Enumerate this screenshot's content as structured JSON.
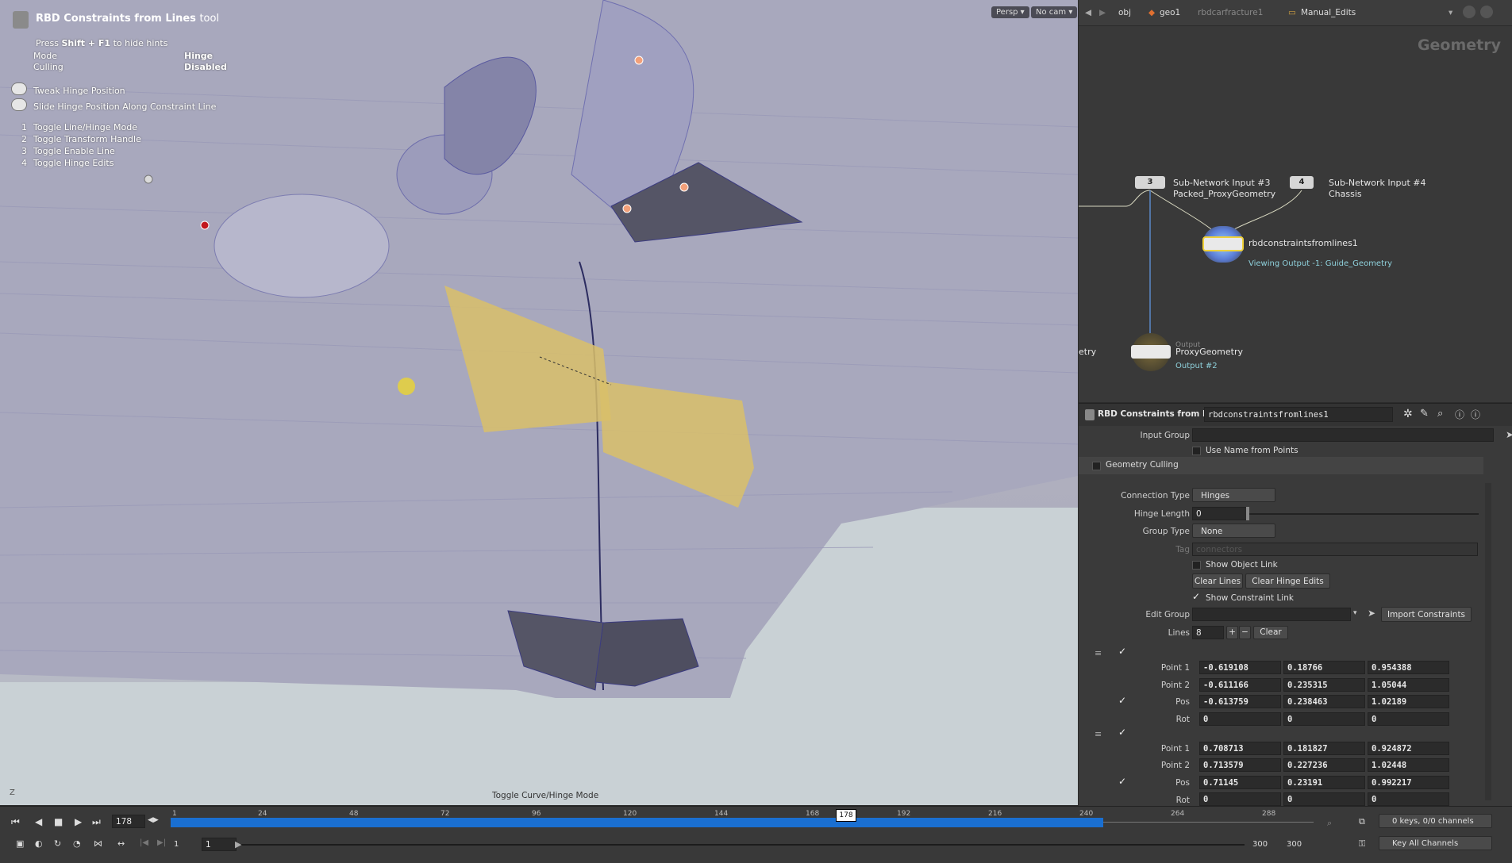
{
  "viewport": {
    "tool_title": "RBD Constraints from Lines",
    "tool_suffix": "tool",
    "hint_press": "Press",
    "hint_keys": "Shift + F1",
    "hint_rest": "to hide hints",
    "mode_label": "Mode",
    "mode_value": "Hinge",
    "culling_label": "Culling",
    "culling_value": "Disabled",
    "mouse_hints": [
      "Tweak Hinge Position",
      "Slide Hinge Position Along Constraint Line"
    ],
    "key_hints": [
      {
        "key": "1",
        "label": "Toggle Line/Hinge Mode"
      },
      {
        "key": "2",
        "label": "Toggle Transform Handle"
      },
      {
        "key": "3",
        "label": "Toggle Enable Line"
      },
      {
        "key": "4",
        "label": "Toggle Hinge Edits"
      }
    ],
    "camera_menu": "Persp",
    "cam_menu": "No cam",
    "status_text": "Toggle Curve/Hinge Mode",
    "axis_label": "Z"
  },
  "network": {
    "breadcrumbs": [
      "obj",
      "geo1",
      "rbdcarfracture1",
      "Manual_Edits"
    ],
    "context_label": "Geometry",
    "nodes": {
      "input3_num": "3",
      "input3_title": "Sub-Network Input #3",
      "input3_sub": "Packed_ProxyGeometry",
      "input4_num": "4",
      "input4_title": "Sub-Network Input #4",
      "input4_sub": "Chassis",
      "rbd_name": "rbdconstraintsfromlines1",
      "rbd_status": "Viewing Output -1: Guide_Geometry",
      "output_tag": "Output",
      "output_name": "ProxyGeometry",
      "output_sub": "Output #2",
      "left_cut": "etry"
    }
  },
  "params": {
    "node_type": "RBD Constraints from Lines",
    "node_name": "rbdconstraintsfromlines1",
    "input_group_label": "Input Group",
    "input_group_value": "",
    "use_name_label": "Use Name from Points",
    "culling_label": "Geometry Culling",
    "connection_type_label": "Connection Type",
    "connection_type_value": "Hinges",
    "hinge_length_label": "Hinge Length",
    "hinge_length_value": "0",
    "group_type_label": "Group Type",
    "group_type_value": "None",
    "tag_label": "Tag",
    "tag_placeholder": "connectors",
    "show_object_link_label": "Show Object Link",
    "clear_lines_label": "Clear Lines",
    "clear_hinge_label": "Clear Hinge Edits",
    "show_constraint_label": "Show Constraint Link",
    "edit_group_label": "Edit Group",
    "import_label": "Import Constraints",
    "lines_label": "Lines",
    "lines_value": "8",
    "clear_label": "Clear",
    "multiparm": [
      {
        "rows": [
          {
            "label": "Point 1",
            "values": [
              "-0.619108",
              "0.18766",
              "0.954388"
            ]
          },
          {
            "label": "Point 2",
            "values": [
              "-0.611166",
              "0.235315",
              "1.05044"
            ]
          },
          {
            "label": "Pos",
            "values": [
              "-0.613759",
              "0.238463",
              "1.02189"
            ]
          },
          {
            "label": "Rot",
            "values": [
              "0",
              "0",
              "0"
            ]
          }
        ]
      },
      {
        "rows": [
          {
            "label": "Point 1",
            "values": [
              "0.708713",
              "0.181827",
              "0.924872"
            ]
          },
          {
            "label": "Point 2",
            "values": [
              "0.713579",
              "0.227236",
              "1.02448"
            ]
          },
          {
            "label": "Pos",
            "values": [
              "0.71145",
              "0.23191",
              "0.992217"
            ]
          },
          {
            "label": "Rot",
            "values": [
              "0",
              "0",
              "0"
            ]
          }
        ]
      }
    ]
  },
  "timeline": {
    "current_frame": "178",
    "frame_marker": "178",
    "ticks": [
      "1",
      "24",
      "48",
      "72",
      "96",
      "120",
      "144",
      "168",
      "192",
      "216",
      "240",
      "264",
      "288"
    ],
    "range_start": "1",
    "range_start2": "1",
    "range_end": "300",
    "range_end2": "300",
    "keys_status": "0 keys, 0/0 channels",
    "key_all_label": "Key All Channels"
  },
  "colors": {
    "accent_blue": "#1a6fd1",
    "selection_yellow": "#e8c24a",
    "node_highlight": "#f0d23a"
  }
}
